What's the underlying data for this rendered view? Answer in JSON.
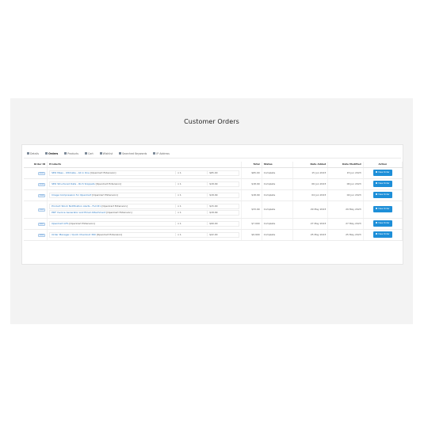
{
  "page": {
    "title": "Customer Orders"
  },
  "tabs": [
    {
      "label": "Details",
      "icon": "chart-icon"
    },
    {
      "label": "Orders",
      "icon": "list-icon",
      "active": true
    },
    {
      "label": "Products",
      "icon": "table-icon"
    },
    {
      "label": "Cart",
      "icon": "cart-icon"
    },
    {
      "label": "Wishlist",
      "icon": "heart-icon"
    },
    {
      "label": "Searched Keywords",
      "icon": "search-icon"
    },
    {
      "label": "IP Address",
      "icon": "globe-icon"
    }
  ],
  "table": {
    "headers": {
      "order_id": "Order ID",
      "products": "Products",
      "total": "Total",
      "status": "Status",
      "date_added": "Date Added",
      "date_modified": "Date Modified",
      "action": "Action"
    },
    "rows": [
      {
        "order_id": "3921",
        "products": [
          {
            "name": "SEO Mass - Ultimate - All in One",
            "tag": "[OpenCart Extension]",
            "qty": "x 1",
            "price": "$65.00"
          }
        ],
        "total": "$65.00",
        "status": "Complete",
        "date_added": "15 Jun 2023",
        "date_modified": "15 Jun 2023",
        "action": "View Order"
      },
      {
        "order_id": "3915",
        "products": [
          {
            "name": "SEO Structured Data - Rich Snippets",
            "tag": "[OpenCart Extension]",
            "qty": "x 1",
            "price": "$18.99"
          }
        ],
        "total": "$18.99",
        "status": "Complete",
        "date_added": "06 Jun 2023",
        "date_modified": "06 Jun 2023",
        "action": "View Order"
      },
      {
        "order_id": "3908",
        "products": [
          {
            "name": "Image Compression for OpenCart",
            "tag": "[OpenCart Extension]",
            "qty": "x 1",
            "price": "$18.99"
          }
        ],
        "total": "$18.99",
        "status": "Complete",
        "date_added": "04 Jun 2023",
        "date_modified": "04 Jun 2023",
        "action": "View Order"
      },
      {
        "order_id": "3902",
        "products": [
          {
            "name": "Product Stock Notification Alerts - Full Pro",
            "tag": "[OpenCart Extension]",
            "qty": "x 1",
            "price": "$15.00"
          },
          {
            "name": "PDF Invoice Generator and Email Attachment",
            "tag": "[OpenCart Extension]",
            "qty": "x 1",
            "price": "$18.99"
          }
        ],
        "total": "$33.99",
        "status": "Complete",
        "date_added": "29 May 2023",
        "date_modified": "29 May 2023",
        "action": "View Order"
      },
      {
        "order_id": "3897",
        "products": [
          {
            "name": "OpenCart GTS",
            "tag": "[OpenCart Extension]",
            "qty": "x 1",
            "price": "$99.00"
          }
        ],
        "total": "$7.000",
        "status": "Complete",
        "date_added": "27 May 2023",
        "date_modified": "27 May 2023",
        "action": "View Order"
      },
      {
        "order_id": "3890",
        "products": [
          {
            "name": "Order Manager / Quick Checkout 360",
            "tag": "[OpenCart Extension]",
            "qty": "x 1",
            "price": "$22.00"
          }
        ],
        "total": "$9.900",
        "status": "Complete",
        "date_added": "25 May 2023",
        "date_modified": "25 May 2023",
        "action": "View Order"
      }
    ]
  },
  "colors": {
    "accent": "#1e8fd8",
    "panel_bg": "#f3f3f3",
    "link": "#2a78c2"
  }
}
